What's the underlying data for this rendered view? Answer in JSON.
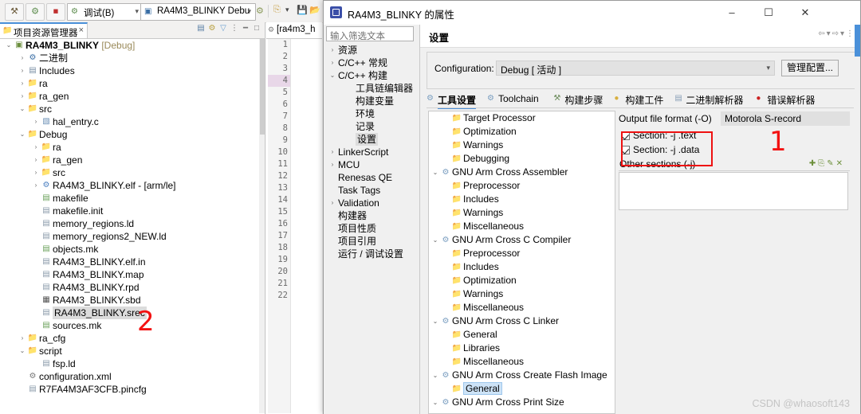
{
  "ide": {
    "toolbar": {
      "buttons": [
        {
          "name": "build-hammer",
          "glyph": "⚒"
        },
        {
          "name": "run-gear",
          "glyph": "⚙"
        },
        {
          "name": "stop",
          "glyph": "■"
        }
      ],
      "launch_mode": {
        "label": "调试(B)",
        "icon": "bug-icon"
      },
      "launch_config": {
        "label": "RA4M3_BLINKY Debu",
        "icon": "launch-icon"
      },
      "right_icons": [
        "new-icon",
        "dropdown-icon",
        "save-icon",
        "save-all-icon"
      ]
    },
    "project_explorer": {
      "tab_label": "项目资源管理器",
      "close_glyph": "×",
      "view_tools": [
        "collapse-all-icon",
        "link-icon",
        "filter-icon",
        "menu-icon",
        "minimize-icon",
        "maximize-icon"
      ],
      "tree": [
        {
          "indent": 0,
          "arrow": "v",
          "icon": "project-icon",
          "label": "RA4M3_BLINKY",
          "suffix": "[Debug]",
          "bold": true
        },
        {
          "indent": 1,
          "arrow": ">",
          "icon": "binaries-icon",
          "label": "二进制"
        },
        {
          "indent": 1,
          "arrow": ">",
          "icon": "includes-icon",
          "label": "Includes"
        },
        {
          "indent": 1,
          "arrow": ">",
          "icon": "srcfolder-icon",
          "label": "ra"
        },
        {
          "indent": 1,
          "arrow": ">",
          "icon": "srcfolder-icon",
          "label": "ra_gen"
        },
        {
          "indent": 1,
          "arrow": "v",
          "icon": "srcfolder-icon",
          "label": "src"
        },
        {
          "indent": 2,
          "arrow": ">",
          "icon": "cfile-icon",
          "label": "hal_entry.c"
        },
        {
          "indent": 1,
          "arrow": "v",
          "icon": "folder-icon",
          "label": "Debug"
        },
        {
          "indent": 2,
          "arrow": ">",
          "icon": "folder-icon",
          "label": "ra"
        },
        {
          "indent": 2,
          "arrow": ">",
          "icon": "folder-icon",
          "label": "ra_gen"
        },
        {
          "indent": 2,
          "arrow": ">",
          "icon": "folder-icon",
          "label": "src"
        },
        {
          "indent": 2,
          "arrow": ">",
          "icon": "elf-icon",
          "label": "RA4M3_BLINKY.elf - [arm/le]"
        },
        {
          "indent": 2,
          "arrow": "",
          "icon": "makefile-icon",
          "label": "makefile"
        },
        {
          "indent": 2,
          "arrow": "",
          "icon": "file-icon",
          "label": "makefile.init"
        },
        {
          "indent": 2,
          "arrow": "",
          "icon": "file-icon",
          "label": "memory_regions.ld"
        },
        {
          "indent": 2,
          "arrow": "",
          "icon": "file-icon",
          "label": "memory_regions2_NEW.ld"
        },
        {
          "indent": 2,
          "arrow": "",
          "icon": "makefile-icon",
          "label": "objects.mk"
        },
        {
          "indent": 2,
          "arrow": "",
          "icon": "file-icon",
          "label": "RA4M3_BLINKY.elf.in"
        },
        {
          "indent": 2,
          "arrow": "",
          "icon": "file-icon",
          "label": "RA4M3_BLINKY.map"
        },
        {
          "indent": 2,
          "arrow": "",
          "icon": "file-icon",
          "label": "RA4M3_BLINKY.rpd"
        },
        {
          "indent": 2,
          "arrow": "",
          "icon": "grid-icon",
          "label": "RA4M3_BLINKY.sbd"
        },
        {
          "indent": 2,
          "arrow": "",
          "icon": "file-icon",
          "label": "RA4M3_BLINKY.srec",
          "selected": true
        },
        {
          "indent": 2,
          "arrow": "",
          "icon": "makefile-icon",
          "label": "sources.mk"
        },
        {
          "indent": 1,
          "arrow": ">",
          "icon": "folder-icon",
          "label": "ra_cfg"
        },
        {
          "indent": 1,
          "arrow": "v",
          "icon": "folder-icon",
          "label": "script"
        },
        {
          "indent": 2,
          "arrow": "",
          "icon": "file-icon",
          "label": "fsp.ld"
        },
        {
          "indent": 1,
          "arrow": "",
          "icon": "xml-icon",
          "label": "configuration.xml"
        },
        {
          "indent": 1,
          "arrow": "",
          "icon": "file-icon",
          "label": "R7FA4M3AF3CFB.pincfg"
        }
      ]
    },
    "editor": {
      "tab_label": "[ra4m3_h",
      "tab_icon": "source-icon",
      "line_numbers": [
        "1",
        "2",
        "3",
        "4",
        "5",
        "6",
        "7",
        "8",
        "9",
        "10",
        "11",
        "12",
        "13",
        "14",
        "15",
        "16",
        "17",
        "18",
        "19",
        "20",
        "21",
        "22"
      ],
      "current_line": "4"
    },
    "annotations": [
      {
        "name": "annotation-2",
        "text": "2"
      },
      {
        "name": "annotation-1",
        "text": "1"
      }
    ],
    "watermark": "CSDN @whaosoft143"
  },
  "dialog": {
    "title": "RA4M3_BLINKY 的属性",
    "icon": "properties-icon",
    "window_buttons": {
      "minimize": "–",
      "maximize": "☐",
      "close": "✕"
    },
    "filter": {
      "placeholder": "输入筛选文本",
      "value": ""
    },
    "nav_tree": [
      {
        "indent": 0,
        "arrow": ">",
        "label": "资源"
      },
      {
        "indent": 0,
        "arrow": ">",
        "label": "C/C++ 常规"
      },
      {
        "indent": 0,
        "arrow": "v",
        "label": "C/C++ 构建"
      },
      {
        "indent": 1,
        "arrow": "",
        "label": "工具链编辑器"
      },
      {
        "indent": 1,
        "arrow": "",
        "label": "构建变量"
      },
      {
        "indent": 1,
        "arrow": "",
        "label": "环境"
      },
      {
        "indent": 1,
        "arrow": "",
        "label": "记录"
      },
      {
        "indent": 1,
        "arrow": "",
        "label": "设置",
        "selected": true
      },
      {
        "indent": 0,
        "arrow": ">",
        "label": "LinkerScript"
      },
      {
        "indent": 0,
        "arrow": ">",
        "label": "MCU"
      },
      {
        "indent": 0,
        "arrow": "",
        "label": "Renesas QE"
      },
      {
        "indent": 0,
        "arrow": "",
        "label": "Task Tags"
      },
      {
        "indent": 0,
        "arrow": ">",
        "label": "Validation"
      },
      {
        "indent": 0,
        "arrow": "",
        "label": "构建器"
      },
      {
        "indent": 0,
        "arrow": "",
        "label": "项目性质"
      },
      {
        "indent": 0,
        "arrow": "",
        "label": "项目引用"
      },
      {
        "indent": 0,
        "arrow": "",
        "label": "运行 / 调试设置"
      }
    ],
    "pane": {
      "title": "设置",
      "header_tools": [
        "back-icon",
        "back-dropdown-icon",
        "forward-icon",
        "forward-dropdown-icon",
        "menu-icon"
      ],
      "configuration": {
        "label": "Configuration:",
        "value": "Debug [ 活动 ]",
        "manage_button": "管理配置..."
      },
      "tabs": [
        {
          "label": "工具设置",
          "icon": "tool-settings-icon",
          "active": true
        },
        {
          "label": "Toolchain",
          "icon": "toolchain-icon",
          "active": false
        },
        {
          "label": "构建步骤",
          "icon": "build-steps-icon",
          "active": false
        },
        {
          "label": "构建工件",
          "icon": "build-artifact-icon",
          "active": false
        },
        {
          "label": "二进制解析器",
          "icon": "binary-parser-icon",
          "active": false
        },
        {
          "label": "错误解析器",
          "icon": "error-parser-icon",
          "active": false
        }
      ],
      "settings_tree": [
        {
          "indent": 1,
          "arrow": "",
          "icon": "option-icon",
          "label": "Target Processor"
        },
        {
          "indent": 1,
          "arrow": "",
          "icon": "option-icon",
          "label": "Optimization"
        },
        {
          "indent": 1,
          "arrow": "",
          "icon": "option-icon",
          "label": "Warnings"
        },
        {
          "indent": 1,
          "arrow": "",
          "icon": "option-icon",
          "label": "Debugging"
        },
        {
          "indent": 0,
          "arrow": "v",
          "icon": "tool-icon",
          "label": "GNU Arm Cross Assembler"
        },
        {
          "indent": 1,
          "arrow": "",
          "icon": "option-icon",
          "label": "Preprocessor"
        },
        {
          "indent": 1,
          "arrow": "",
          "icon": "option-icon",
          "label": "Includes"
        },
        {
          "indent": 1,
          "arrow": "",
          "icon": "option-icon",
          "label": "Warnings"
        },
        {
          "indent": 1,
          "arrow": "",
          "icon": "option-icon",
          "label": "Miscellaneous"
        },
        {
          "indent": 0,
          "arrow": "v",
          "icon": "tool-icon",
          "label": "GNU Arm Cross C Compiler"
        },
        {
          "indent": 1,
          "arrow": "",
          "icon": "option-icon",
          "label": "Preprocessor"
        },
        {
          "indent": 1,
          "arrow": "",
          "icon": "option-icon",
          "label": "Includes"
        },
        {
          "indent": 1,
          "arrow": "",
          "icon": "option-icon",
          "label": "Optimization"
        },
        {
          "indent": 1,
          "arrow": "",
          "icon": "option-icon",
          "label": "Warnings"
        },
        {
          "indent": 1,
          "arrow": "",
          "icon": "option-icon",
          "label": "Miscellaneous"
        },
        {
          "indent": 0,
          "arrow": "v",
          "icon": "tool-icon",
          "label": "GNU Arm Cross C Linker"
        },
        {
          "indent": 1,
          "arrow": "",
          "icon": "option-icon",
          "label": "General"
        },
        {
          "indent": 1,
          "arrow": "",
          "icon": "option-icon",
          "label": "Libraries"
        },
        {
          "indent": 1,
          "arrow": "",
          "icon": "option-icon",
          "label": "Miscellaneous"
        },
        {
          "indent": 0,
          "arrow": "v",
          "icon": "tool-icon",
          "label": "GNU Arm Cross Create Flash Image"
        },
        {
          "indent": 1,
          "arrow": "",
          "icon": "option-icon",
          "label": "General",
          "selected": true
        },
        {
          "indent": 0,
          "arrow": "v",
          "icon": "tool-icon",
          "label": "GNU Arm Cross Print Size"
        }
      ],
      "options": {
        "output_file_format_label": "Output file format (-O)",
        "output_file_format_value": "Motorola S-record",
        "checkboxes": [
          {
            "label": "Section: -j .text",
            "checked": true
          },
          {
            "label": "Section: -j .data",
            "checked": true
          }
        ],
        "other_sections_label": "Other sections (-j)",
        "other_sections_tools": [
          "add-icon",
          "duplicate-icon",
          "edit-icon",
          "delete-icon"
        ],
        "other_sections_items": []
      }
    }
  },
  "colors": {
    "accent": "#4a90d9",
    "annotation_red": "#f31212",
    "selection_blue": "#cde3f7",
    "dim_gold": "#9a8a5a"
  }
}
